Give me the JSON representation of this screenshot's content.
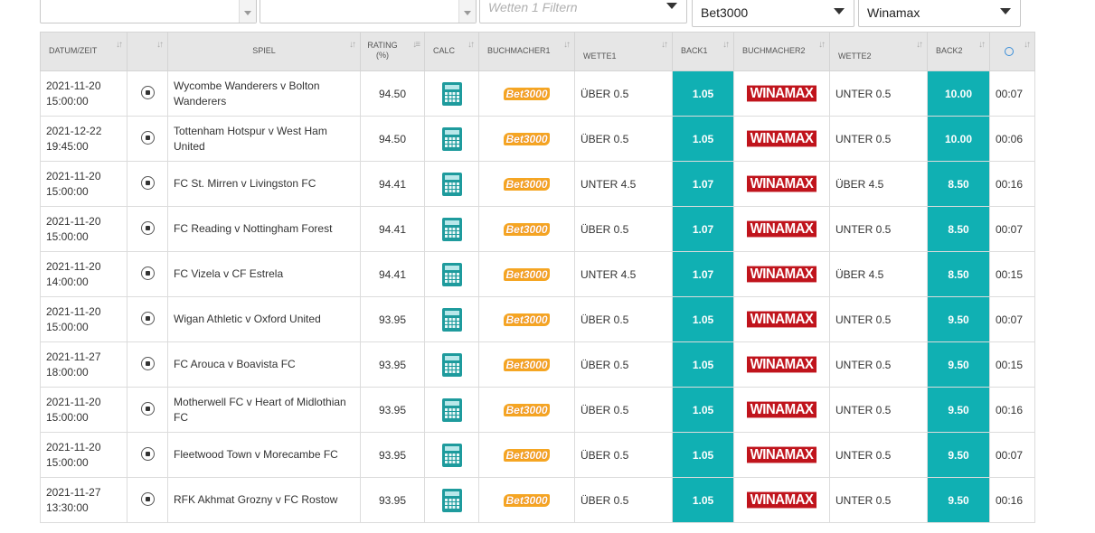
{
  "filters": {
    "filter3_placeholder": "Wetten 1 Filtern",
    "bookmaker1_value": "Bet3000",
    "bookmaker2_value": "Winamax"
  },
  "columns": {
    "date": "DATUM/ZEIT",
    "sport": "",
    "game": "SPIEL",
    "rating_line1": "RATING",
    "rating_line2": "(%)",
    "calc": "CALC",
    "bookmaker1": "BUCHMACHER1",
    "bet1": "WETTE1",
    "back1": "BACK1",
    "bookmaker2": "BUCHMACHER2",
    "bet2": "WETTE2",
    "back2": "BACK2",
    "time_icon": "clock-icon"
  },
  "logos": {
    "bet3000": "Bet3000",
    "winamax": "WINAMAX"
  },
  "colors": {
    "back_cell": "#10b0b3",
    "header_bg": "#e6e6e6",
    "winamax_red": "#c0141c",
    "bet3000_orange": "#f39c12"
  },
  "rows": [
    {
      "date": "2021-11-20",
      "time": "15:00:00",
      "game": "Wycombe Wanderers v Bolton Wanderers",
      "rating": "94.50",
      "bet1": "ÜBER 0.5",
      "back1": "1.05",
      "bet2": "UNTER 0.5",
      "back2": "10.00",
      "age": "00:07"
    },
    {
      "date": "2021-12-22",
      "time": "19:45:00",
      "game": "Tottenham Hotspur v West Ham United",
      "rating": "94.50",
      "bet1": "ÜBER 0.5",
      "back1": "1.05",
      "bet2": "UNTER 0.5",
      "back2": "10.00",
      "age": "00:06"
    },
    {
      "date": "2021-11-20",
      "time": "15:00:00",
      "game": "FC St. Mirren v Livingston FC",
      "rating": "94.41",
      "bet1": "UNTER 4.5",
      "back1": "1.07",
      "bet2": "ÜBER 4.5",
      "back2": "8.50",
      "age": "00:16"
    },
    {
      "date": "2021-11-20",
      "time": "15:00:00",
      "game": "FC Reading v Nottingham Forest",
      "rating": "94.41",
      "bet1": "ÜBER 0.5",
      "back1": "1.07",
      "bet2": "UNTER 0.5",
      "back2": "8.50",
      "age": "00:07"
    },
    {
      "date": "2021-11-20",
      "time": "14:00:00",
      "game": "FC Vizela v CF Estrela",
      "rating": "94.41",
      "bet1": "UNTER 4.5",
      "back1": "1.07",
      "bet2": "ÜBER 4.5",
      "back2": "8.50",
      "age": "00:15"
    },
    {
      "date": "2021-11-20",
      "time": "15:00:00",
      "game": "Wigan Athletic v Oxford United",
      "rating": "93.95",
      "bet1": "ÜBER 0.5",
      "back1": "1.05",
      "bet2": "UNTER 0.5",
      "back2": "9.50",
      "age": "00:07"
    },
    {
      "date": "2021-11-27",
      "time": "18:00:00",
      "game": "FC Arouca v Boavista FC",
      "rating": "93.95",
      "bet1": "ÜBER 0.5",
      "back1": "1.05",
      "bet2": "UNTER 0.5",
      "back2": "9.50",
      "age": "00:15"
    },
    {
      "date": "2021-11-20",
      "time": "15:00:00",
      "game": "Motherwell FC v Heart of Midlothian FC",
      "rating": "93.95",
      "bet1": "ÜBER 0.5",
      "back1": "1.05",
      "bet2": "UNTER 0.5",
      "back2": "9.50",
      "age": "00:16"
    },
    {
      "date": "2021-11-20",
      "time": "15:00:00",
      "game": "Fleetwood Town v Morecambe FC",
      "rating": "93.95",
      "bet1": "ÜBER 0.5",
      "back1": "1.05",
      "bet2": "UNTER 0.5",
      "back2": "9.50",
      "age": "00:07"
    },
    {
      "date": "2021-11-27",
      "time": "13:30:00",
      "game": "RFK Akhmat Grozny v FC Rostow",
      "rating": "93.95",
      "bet1": "ÜBER 0.5",
      "back1": "1.05",
      "bet2": "UNTER 0.5",
      "back2": "9.50",
      "age": "00:16"
    }
  ]
}
